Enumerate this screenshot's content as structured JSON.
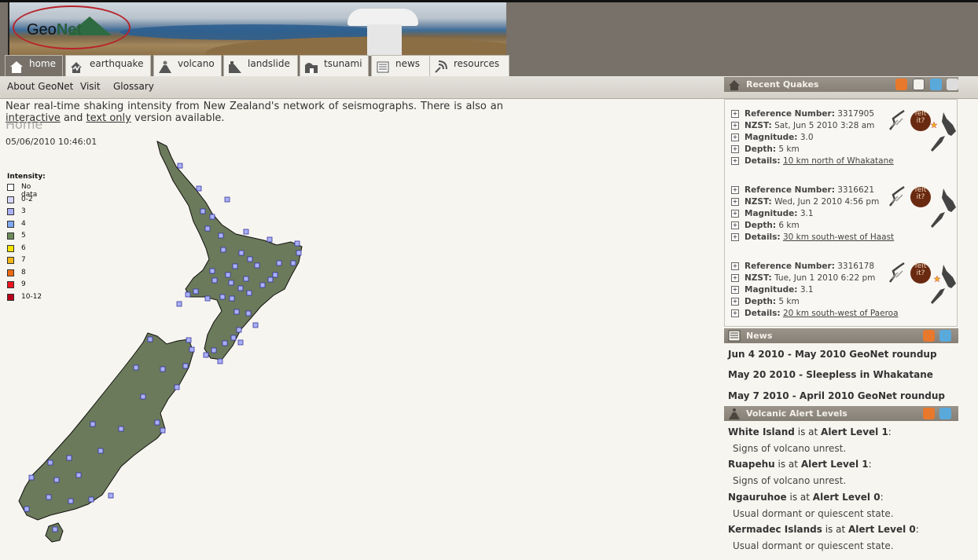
{
  "header": {
    "logo_text_a": "Geo",
    "logo_text_b": "Net"
  },
  "tabs": [
    {
      "label": "home",
      "icon": "home-icon",
      "active": true
    },
    {
      "label": "earthquake",
      "icon": "earthquake-icon"
    },
    {
      "label": "volcano",
      "icon": "volcano-icon"
    },
    {
      "label": "landslide",
      "icon": "landslide-icon"
    },
    {
      "label": "tsunami",
      "icon": "tsunami-icon"
    },
    {
      "label": "news",
      "icon": "news-icon"
    },
    {
      "label": "resources",
      "icon": "resources-icon"
    }
  ],
  "subnav": [
    "About GeoNet",
    "Visit",
    "Glossary"
  ],
  "main": {
    "intro_pre": "Near real-time shaking intensity from New Zealand's network of seismographs. There is also an",
    "intro_link1": "interactive",
    "intro_mid": "and",
    "intro_link2": "text only",
    "intro_post": "version available.",
    "page_title": "Home",
    "timestamp": "05/06/2010 10:46:01"
  },
  "legend": {
    "title": "Intensity:",
    "items": [
      {
        "label": "No data",
        "color": "#ffffff"
      },
      {
        "label": "0-2",
        "color": "#d6d6ff"
      },
      {
        "label": "3",
        "color": "#a9b0f5"
      },
      {
        "label": "4",
        "color": "#7fa8f0"
      },
      {
        "label": "5",
        "color": "#6b8a5a"
      },
      {
        "label": "6",
        "color": "#f4e400"
      },
      {
        "label": "7",
        "color": "#f2b51a"
      },
      {
        "label": "8",
        "color": "#ef6b12"
      },
      {
        "label": "9",
        "color": "#ef1420"
      },
      {
        "label": "10-12",
        "color": "#b8001a"
      }
    ]
  },
  "recent_quakes": {
    "title": "Recent Quakes",
    "items": [
      {
        "ref_label": "Reference Number:",
        "ref": "3317905",
        "nzst_label": "NZST:",
        "nzst": "Sat, Jun 5 2010 3:28 am",
        "mag_label": "Magnitude:",
        "mag": "3.0",
        "depth_label": "Depth:",
        "depth": "5 km",
        "details_label": "Details:",
        "details": "10 km north of Whakatane"
      },
      {
        "ref_label": "Reference Number:",
        "ref": "3316621",
        "nzst_label": "NZST:",
        "nzst": "Wed, Jun 2 2010 4:56 pm",
        "mag_label": "Magnitude:",
        "mag": "3.1",
        "depth_label": "Depth:",
        "depth": "6 km",
        "details_label": "Details:",
        "details": "30 km south-west of Haast"
      },
      {
        "ref_label": "Reference Number:",
        "ref": "3316178",
        "nzst_label": "NZST:",
        "nzst": "Tue, Jun 1 2010 6:22 pm",
        "mag_label": "Magnitude:",
        "mag": "3.1",
        "depth_label": "Depth:",
        "depth": "5 km",
        "details_label": "Details:",
        "details": "20 km south-west of Paeroa"
      }
    ],
    "felt_label": "felt it?"
  },
  "news": {
    "title": "News",
    "items": [
      "Jun 4 2010 - May 2010 GeoNet roundup",
      "May 20 2010 - Sleepless in Whakatane",
      "May 7 2010 - April 2010 GeoNet roundup"
    ]
  },
  "volcanic": {
    "title": "Volcanic Alert Levels",
    "is_at": "is at",
    "items": [
      {
        "name": "White Island",
        "level": "Alert Level 1",
        "desc": "Signs of volcano unrest."
      },
      {
        "name": "Ruapehu",
        "level": "Alert Level 1",
        "desc": "Signs of volcano unrest."
      },
      {
        "name": "Ngauruhoe",
        "level": "Alert Level 0",
        "desc": "Usual dormant or quiescent state."
      },
      {
        "name": "Kermadec Islands",
        "level": "Alert Level 0",
        "desc": "Usual dormant or quiescent state."
      }
    ]
  }
}
